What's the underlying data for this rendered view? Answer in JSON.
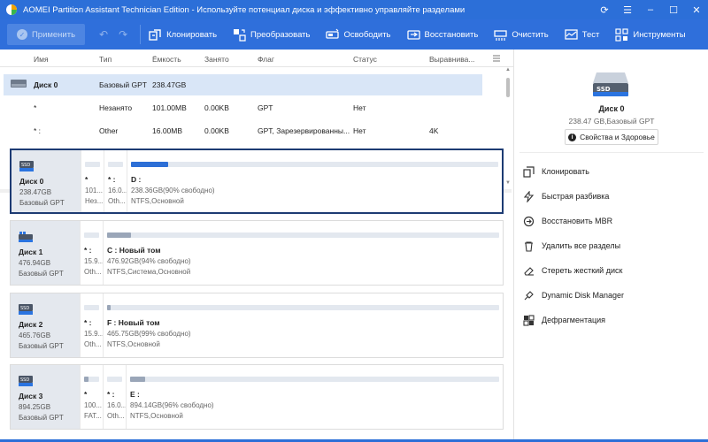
{
  "window": {
    "title": "AOMEI Partition Assistant Technician Edition - Используйте потенциал диска и эффективно управляйте разделами"
  },
  "toolbar": {
    "apply_label": "Применить",
    "items": [
      {
        "label": "Клонировать",
        "icon": "clone-icon"
      },
      {
        "label": "Преобразовать",
        "icon": "convert-icon"
      },
      {
        "label": "Освободить",
        "icon": "free-space-icon"
      },
      {
        "label": "Восстановить",
        "icon": "recover-icon"
      },
      {
        "label": "Очистить",
        "icon": "wipe-icon"
      },
      {
        "label": "Тест",
        "icon": "test-icon"
      },
      {
        "label": "Инструменты",
        "icon": "tools-icon"
      }
    ]
  },
  "table": {
    "headers": [
      "Имя",
      "Тип",
      "Ёмкость",
      "Занято",
      "Флаг",
      "Статус",
      "Выравнива..."
    ],
    "rows": [
      {
        "name": "Диск 0",
        "type": "Базовый GPT",
        "capacity": "238.47GB",
        "used": "",
        "flag": "",
        "status": "",
        "align": "",
        "selected": true
      },
      {
        "name": "*",
        "type": "Незанято",
        "capacity": "101.00MB",
        "used": "0.00KB",
        "flag": "GPT",
        "status": "Нет",
        "align": ""
      },
      {
        "name": "* :",
        "type": "Other",
        "capacity": "16.00MB",
        "used": "0.00KB",
        "flag": "GPT, Зарезервированны...",
        "status": "Нет",
        "align": "4K"
      }
    ]
  },
  "disks": [
    {
      "name": "Диск 0",
      "size": "238.47GB",
      "type": "Базовый GPT",
      "active": true,
      "partitions": [
        {
          "name": "*",
          "info1": "101...",
          "info2": "Нез...",
          "used_fraction": 0.0
        },
        {
          "name": "* :",
          "info1": "16.0...",
          "info2": "Oth...",
          "used_fraction": 0.0
        },
        {
          "name": "D :",
          "info1": "238.36GB(90% свободно)",
          "info2": "NTFS,Основной",
          "used_fraction": 0.1
        }
      ]
    },
    {
      "name": "Диск 1",
      "size": "476.94GB",
      "type": "Базовый GPT",
      "active": false,
      "partitions": [
        {
          "name": "* :",
          "info1": "15.9...",
          "info2": "Oth...",
          "used_fraction": 0.0
        },
        {
          "name": "C : Новый том",
          "info1": "476.92GB(94% свободно)",
          "info2": "NTFS,Система,Основной",
          "used_fraction": 0.06
        }
      ]
    },
    {
      "name": "Диск 2",
      "size": "465.76GB",
      "type": "Базовый GPT",
      "active": false,
      "partitions": [
        {
          "name": "* :",
          "info1": "15.9...",
          "info2": "Oth...",
          "used_fraction": 0.0
        },
        {
          "name": "F : Новый том",
          "info1": "465.75GB(99% свободно)",
          "info2": "NTFS,Основной",
          "used_fraction": 0.01
        }
      ]
    },
    {
      "name": "Диск 3",
      "size": "894.25GB",
      "type": "Базовый GPT",
      "active": false,
      "partitions": [
        {
          "name": "*",
          "info1": "100...",
          "info2": "FAT...",
          "used_fraction": 0.3
        },
        {
          "name": "* :",
          "info1": "16.0...",
          "info2": "Oth...",
          "used_fraction": 0.0
        },
        {
          "name": "E :",
          "info1": "894.14GB(96% свободно)",
          "info2": "NTFS,Основной",
          "used_fraction": 0.04
        }
      ]
    }
  ],
  "right_panel": {
    "disk_name": "Диск 0",
    "disk_sub": "238.47 GB,Базовый GPT",
    "props_label": "Свойства и Здоровье",
    "actions": [
      {
        "label": "Клонировать",
        "icon": "clone-disk-icon"
      },
      {
        "label": "Быстрая разбивка",
        "icon": "quick-partition-icon"
      },
      {
        "label": "Восстановить MBR",
        "icon": "rebuild-mbr-icon"
      },
      {
        "label": "Удалить все разделы",
        "icon": "trash-icon"
      },
      {
        "label": "Стереть жесткий диск",
        "icon": "eraser-icon"
      },
      {
        "label": "Dynamic Disk Manager",
        "icon": "dynamic-disk-icon"
      },
      {
        "label": "Дефрагментация",
        "icon": "defrag-icon"
      }
    ]
  },
  "colors": {
    "titlebar": "#2c6fd8",
    "toolbar": "#2f6fdb",
    "used_bar_active": "#2d6fd6",
    "used_bar": "#9aa6b8",
    "active_border": "#1d3b73"
  }
}
